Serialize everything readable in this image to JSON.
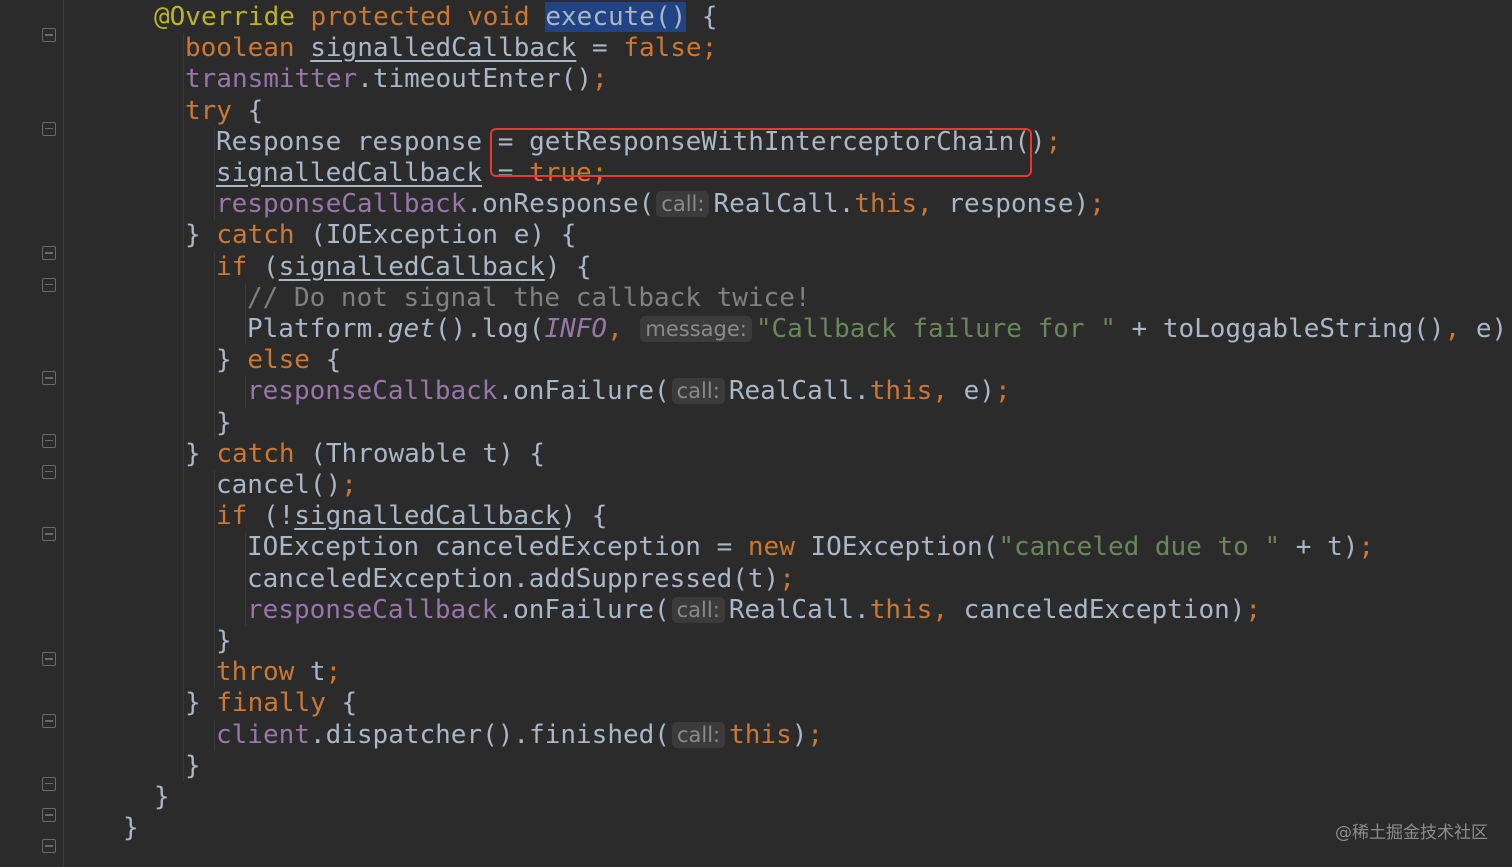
{
  "editor": {
    "lines": [
      {
        "indent": 4,
        "tokens": [
          {
            "text": "@Override",
            "style": "ann"
          },
          {
            "text": " "
          },
          {
            "text": "protected",
            "style": "kw"
          },
          {
            "text": " "
          },
          {
            "text": "void",
            "style": "kw"
          },
          {
            "text": " "
          },
          {
            "text": "execute()",
            "style": "sel"
          },
          {
            "text": " {"
          }
        ]
      },
      {
        "indent": 5,
        "tokens": [
          {
            "text": "boolean",
            "style": "kw"
          },
          {
            "text": " "
          },
          {
            "text": "signalledCallback",
            "style": "ul"
          },
          {
            "text": " = "
          },
          {
            "text": "false",
            "style": "kw"
          },
          {
            "text": ";",
            "style": "kw"
          }
        ]
      },
      {
        "indent": 5,
        "tokens": [
          {
            "text": "transmitter",
            "style": "fld"
          },
          {
            "text": ".timeoutEnter()"
          },
          {
            "text": ";",
            "style": "kw"
          }
        ]
      },
      {
        "indent": 5,
        "tokens": [
          {
            "text": "try",
            "style": "kw"
          },
          {
            "text": " {"
          }
        ]
      },
      {
        "indent": 6,
        "tokens": [
          {
            "text": "Response response = "
          },
          {
            "text": "getResponseWithInterceptorChain()"
          },
          {
            "text": ";",
            "style": "kw"
          }
        ]
      },
      {
        "indent": 6,
        "tokens": [
          {
            "text": "signalledCallback",
            "style": "ul"
          },
          {
            "text": " = "
          },
          {
            "text": "true",
            "style": "kw"
          },
          {
            "text": ";",
            "style": "kw"
          }
        ]
      },
      {
        "indent": 6,
        "tokens": [
          {
            "text": "responseCallback",
            "style": "fld"
          },
          {
            "text": ".onResponse("
          },
          {
            "text": "call:",
            "style": "hint"
          },
          {
            "text": "RealCall."
          },
          {
            "text": "this",
            "style": "kw"
          },
          {
            "text": ",",
            "style": "kw"
          },
          {
            "text": " response)"
          },
          {
            "text": ";",
            "style": "kw"
          }
        ]
      },
      {
        "indent": 5,
        "tokens": [
          {
            "text": "} "
          },
          {
            "text": "catch",
            "style": "kw"
          },
          {
            "text": " (IOException e) {"
          }
        ]
      },
      {
        "indent": 6,
        "tokens": [
          {
            "text": "if",
            "style": "kw"
          },
          {
            "text": " ("
          },
          {
            "text": "signalledCallback",
            "style": "ul"
          },
          {
            "text": ") {"
          }
        ]
      },
      {
        "indent": 7,
        "tokens": [
          {
            "text": "// Do not signal the callback twice!",
            "style": "com"
          }
        ]
      },
      {
        "indent": 7,
        "tokens": [
          {
            "text": "Platform."
          },
          {
            "text": "get",
            "style": "ital"
          },
          {
            "text": "().log("
          },
          {
            "text": "INFO",
            "style": "fld-ital"
          },
          {
            "text": ",",
            "style": "kw"
          },
          {
            "text": " "
          },
          {
            "text": "message:",
            "style": "hint"
          },
          {
            "text": "\"Callback failure for \"",
            "style": "str"
          },
          {
            "text": " + toLoggableString()"
          },
          {
            "text": ",",
            "style": "kw"
          },
          {
            "text": " e)"
          },
          {
            "text": ";",
            "style": "kw"
          }
        ]
      },
      {
        "indent": 6,
        "tokens": [
          {
            "text": "} "
          },
          {
            "text": "else",
            "style": "kw"
          },
          {
            "text": " {"
          }
        ]
      },
      {
        "indent": 7,
        "tokens": [
          {
            "text": "responseCallback",
            "style": "fld"
          },
          {
            "text": ".onFailure("
          },
          {
            "text": "call:",
            "style": "hint"
          },
          {
            "text": "RealCall."
          },
          {
            "text": "this",
            "style": "kw"
          },
          {
            "text": ",",
            "style": "kw"
          },
          {
            "text": " e)"
          },
          {
            "text": ";",
            "style": "kw"
          }
        ]
      },
      {
        "indent": 6,
        "tokens": [
          {
            "text": "}"
          }
        ]
      },
      {
        "indent": 5,
        "tokens": [
          {
            "text": "} "
          },
          {
            "text": "catch",
            "style": "kw"
          },
          {
            "text": " (Throwable t) {"
          }
        ]
      },
      {
        "indent": 6,
        "tokens": [
          {
            "text": "cancel()"
          },
          {
            "text": ";",
            "style": "kw"
          }
        ]
      },
      {
        "indent": 6,
        "tokens": [
          {
            "text": "if",
            "style": "kw"
          },
          {
            "text": " (!"
          },
          {
            "text": "signalledCallback",
            "style": "ul"
          },
          {
            "text": ") {"
          }
        ]
      },
      {
        "indent": 7,
        "tokens": [
          {
            "text": "IOException canceledException = "
          },
          {
            "text": "new",
            "style": "kw"
          },
          {
            "text": " IOException("
          },
          {
            "text": "\"canceled due to \"",
            "style": "str"
          },
          {
            "text": " + t)"
          },
          {
            "text": ";",
            "style": "kw"
          }
        ]
      },
      {
        "indent": 7,
        "tokens": [
          {
            "text": "canceledException.addSuppressed(t)"
          },
          {
            "text": ";",
            "style": "kw"
          }
        ]
      },
      {
        "indent": 7,
        "tokens": [
          {
            "text": "responseCallback",
            "style": "fld"
          },
          {
            "text": ".onFailure("
          },
          {
            "text": "call:",
            "style": "hint"
          },
          {
            "text": "RealCall."
          },
          {
            "text": "this",
            "style": "kw"
          },
          {
            "text": ",",
            "style": "kw"
          },
          {
            "text": " canceledException)"
          },
          {
            "text": ";",
            "style": "kw"
          }
        ]
      },
      {
        "indent": 6,
        "tokens": [
          {
            "text": "}"
          }
        ]
      },
      {
        "indent": 6,
        "tokens": [
          {
            "text": "throw",
            "style": "kw"
          },
          {
            "text": " t"
          },
          {
            "text": ";",
            "style": "kw"
          }
        ]
      },
      {
        "indent": 5,
        "tokens": [
          {
            "text": "} "
          },
          {
            "text": "finally",
            "style": "kw"
          },
          {
            "text": " {"
          }
        ]
      },
      {
        "indent": 6,
        "tokens": [
          {
            "text": "client",
            "style": "fld"
          },
          {
            "text": ".dispatcher().finished("
          },
          {
            "text": "call:",
            "style": "hint"
          },
          {
            "text": "this",
            "style": "kw"
          },
          {
            "text": ")"
          },
          {
            "text": ";",
            "style": "kw"
          }
        ]
      },
      {
        "indent": 5,
        "tokens": [
          {
            "text": "}"
          }
        ]
      },
      {
        "indent": 4,
        "tokens": [
          {
            "text": "}"
          }
        ]
      },
      {
        "indent": 3,
        "tokens": [
          {
            "text": "}"
          }
        ]
      }
    ]
  },
  "annotation": {
    "highlight_target": "getResponseWithInterceptorChain();",
    "color": "#e8392c"
  },
  "watermark": "@稀土掘金技术社区",
  "colors": {
    "background": "#2b2b2b",
    "plain": "#a9b7c6",
    "keyword": "#cc7832",
    "annotation": "#bbb529",
    "field": "#9876aa",
    "string": "#6a8759",
    "comment": "#808080",
    "selection": "#214283"
  }
}
